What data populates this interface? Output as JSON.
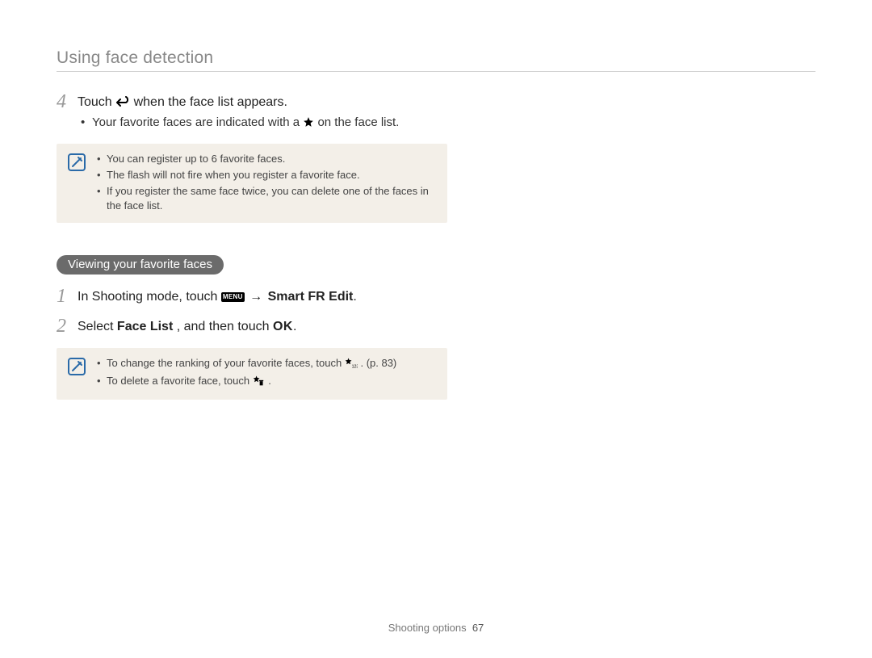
{
  "header": {
    "title": "Using face detection"
  },
  "step4": {
    "number": "4",
    "text_before": "Touch ",
    "text_after": " when the face list appears.",
    "sub_bullet_before": "Your favorite faces are indicated with a ",
    "sub_bullet_after": " on the face list."
  },
  "info1": {
    "items": [
      "You can register up to 6 favorite faces.",
      "The flash will not fire when you register a favorite face.",
      "If you register the same face twice, you can delete one of the faces in the face list."
    ]
  },
  "section_heading": "Viewing your favorite faces",
  "step1": {
    "number": "1",
    "text_before": "In Shooting mode, touch ",
    "menu_label": "MENU",
    "arrow": " → ",
    "bold_text": "Smart FR Edit",
    "period": "."
  },
  "step2": {
    "number": "2",
    "text_before": "Select ",
    "bold1": "Face List",
    "text_mid": ", and then touch ",
    "ok": "OK",
    "period": "."
  },
  "info2": {
    "item1_before": "To change the ranking of your favorite faces, touch ",
    "item1_after": ". (p. 83)",
    "item2_before": "To delete a favorite face, touch ",
    "item2_after": "."
  },
  "footer": {
    "section": "Shooting options",
    "page": "67"
  }
}
